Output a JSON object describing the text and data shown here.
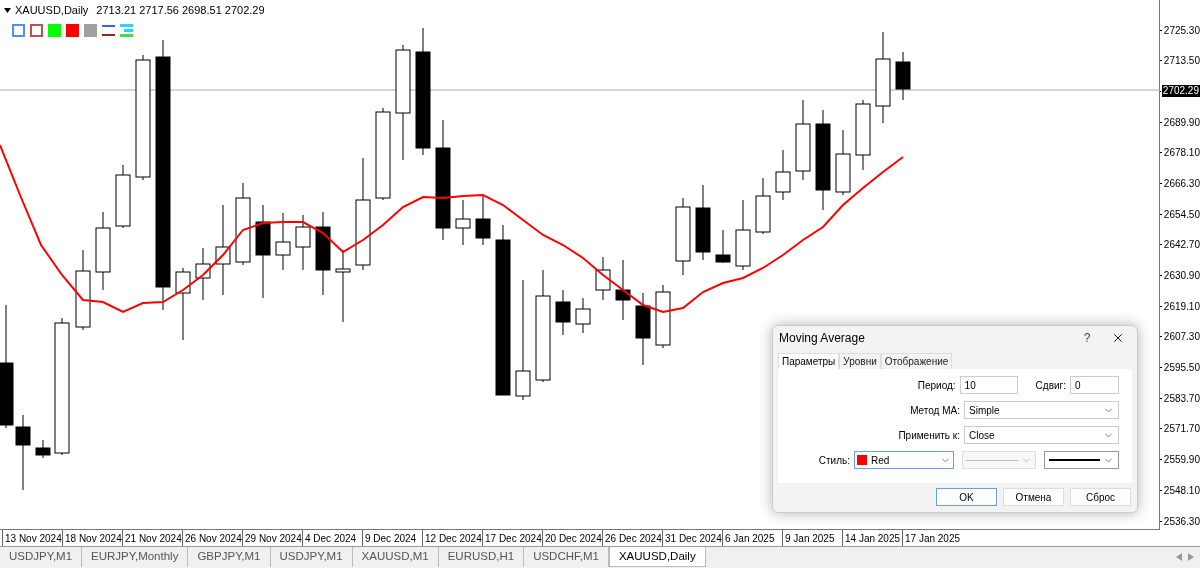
{
  "chart": {
    "symbol": "XAUUSD,Daily",
    "ohlc": "2713.21 2717.56 2698.51 2702.29",
    "current_price": "2702.29",
    "price_axis": [
      "2725.30",
      "2713.50",
      "2689.90",
      "2678.10",
      "2666.30",
      "2654.50",
      "2642.70",
      "2630.90",
      "2619.10",
      "2607.30",
      "2595.50",
      "2583.70",
      "2571.70",
      "2559.90",
      "2548.10",
      "2536.30"
    ],
    "time_axis": [
      "13 Nov 2024",
      "18 Nov 2024",
      "21 Nov 2024",
      "26 Nov 2024",
      "29 Nov 2024",
      "4 Dec 2024",
      "9 Dec 2024",
      "12 Dec 2024",
      "17 Dec 2024",
      "20 Dec 2024",
      "26 Dec 2024",
      "31 Dec 2024",
      "6 Jan 2025",
      "9 Jan 2025",
      "14 Jan 2025",
      "17 Jan 2025"
    ]
  },
  "chart_tabs": [
    {
      "label": "USDJPY,M1",
      "selected": false
    },
    {
      "label": "EURJPY,Monthly",
      "selected": false
    },
    {
      "label": "GBPJPY,M1",
      "selected": false
    },
    {
      "label": "USDJPY,M1",
      "selected": false
    },
    {
      "label": "XAUUSD,M1",
      "selected": false
    },
    {
      "label": "EURUSD,H1",
      "selected": false
    },
    {
      "label": "USDCHF,M1",
      "selected": false
    },
    {
      "label": "XAUUSD,Daily",
      "selected": true
    }
  ],
  "dialog": {
    "title": "Moving Average",
    "help": "?",
    "tabs": [
      {
        "label": "Параметры",
        "selected": true
      },
      {
        "label": "Уровни",
        "selected": false
      },
      {
        "label": "Отображение",
        "selected": false
      }
    ],
    "period": {
      "label": "Период:",
      "value": "10"
    },
    "shift": {
      "label": "Сдвиг:",
      "value": "0"
    },
    "method": {
      "label": "Метод MA:",
      "value": "Simple"
    },
    "apply_to": {
      "label": "Применить к:",
      "value": "Close"
    },
    "style": {
      "label": "Стиль:",
      "color_name": "Red",
      "color": "#ff0000"
    },
    "buttons": [
      "OK",
      "Отмена",
      "Сброс"
    ]
  }
}
